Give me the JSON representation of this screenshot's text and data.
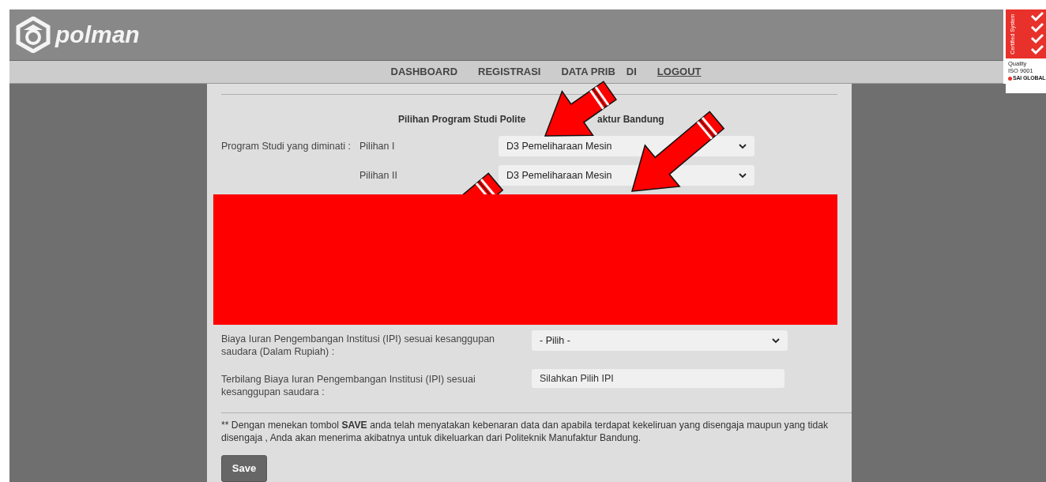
{
  "header": {
    "logo_text": "polman"
  },
  "nav": [
    {
      "parts": [
        "DASHBOARD"
      ],
      "underlined": false
    },
    {
      "parts": [
        "REGISTRASI"
      ],
      "underlined": false
    },
    {
      "parts": [
        "DATA PRIB",
        "DI"
      ],
      "underlined": false
    },
    {
      "parts": [
        "LOGOUT"
      ],
      "underlined": true
    }
  ],
  "badge": {
    "vertical": "Certified System",
    "lines": [
      "Quality",
      "ISO 9001"
    ],
    "brand": "SAI GLOBAL"
  },
  "form": {
    "heading_parts": [
      "Pilihan Program Studi Polite",
      "aktur Bandung"
    ],
    "program": {
      "label": "Program Studi yang diminati :",
      "choices": [
        {
          "label": "Pilihan I",
          "value": "D3 Pemeliharaan Mesin"
        },
        {
          "label": "Pilihan II",
          "value": "D3 Pemeliharaan Mesin"
        }
      ]
    },
    "ipi": {
      "label": "Biaya Iuran Pengembangan Institusi (IPI) sesuai kesanggupan saudara (Dalam Rupiah) :",
      "value": "- Pilih -"
    },
    "terbilang": {
      "label": "Terbilang Biaya Iuran Pengembangan Institusi (IPI) sesuai kesanggupan saudara :",
      "value": "Silahkan Pilih IPI"
    },
    "note": "** Dengan menekan tombol **SAVE** anda telah menyatakan kebenaran data dan apabila terdapat kekeliruan yang disengaja maupun yang tidak disengaja , Anda akan menerima akibatnya untuk dikeluarkan dari Politeknik Manufaktur Bandung.",
    "save_button": "Save"
  }
}
